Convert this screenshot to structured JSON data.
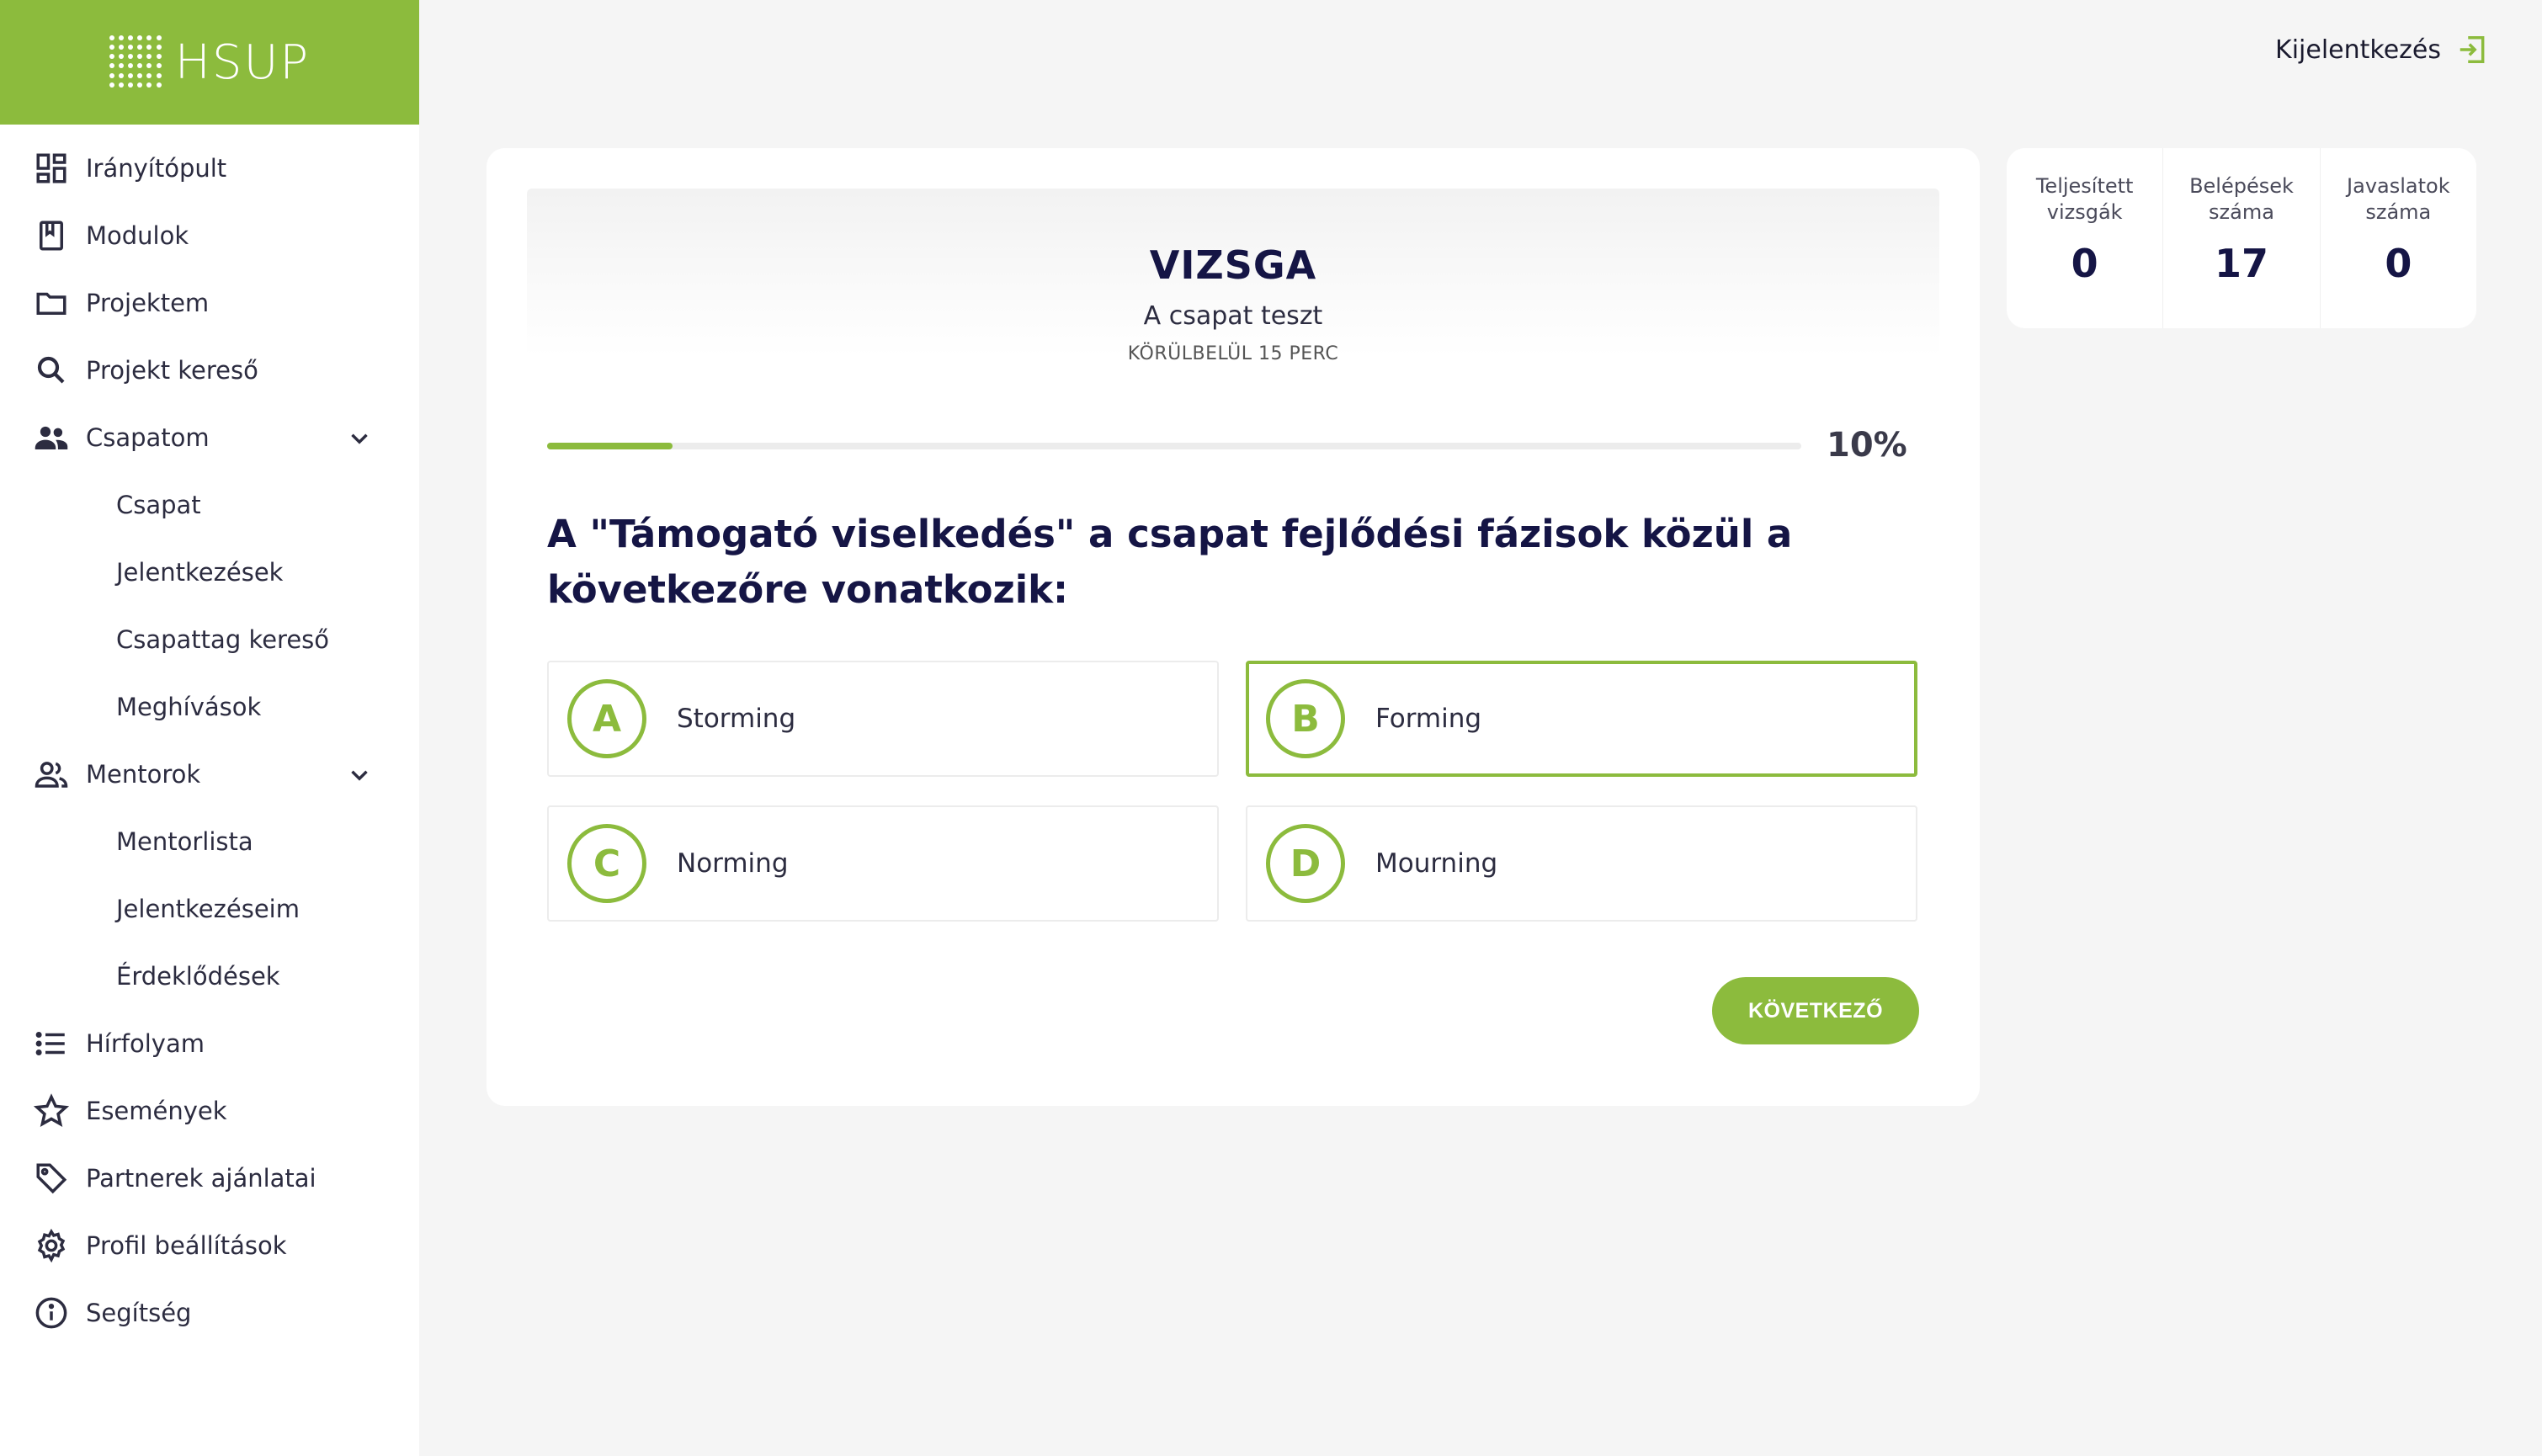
{
  "app": {
    "logo_text": "HSUP"
  },
  "topbar": {
    "logout_label": "Kijelentkezés"
  },
  "sidebar": {
    "items": [
      {
        "label": "Irányítópult",
        "icon": "dashboard-icon"
      },
      {
        "label": "Modulok",
        "icon": "book-icon"
      },
      {
        "label": "Projektem",
        "icon": "folder-icon"
      },
      {
        "label": "Projekt kereső",
        "icon": "search-icon"
      },
      {
        "label": "Csapatom",
        "icon": "group-icon",
        "expanded": true
      },
      {
        "label": "Csapat"
      },
      {
        "label": "Jelentkezések"
      },
      {
        "label": "Csapattag kereső"
      },
      {
        "label": "Meghívások"
      },
      {
        "label": "Mentorok",
        "icon": "people-outline-icon",
        "expanded": true
      },
      {
        "label": "Mentorlista"
      },
      {
        "label": "Jelentkezéseim"
      },
      {
        "label": "Érdeklődések"
      },
      {
        "label": "Hírfolyam",
        "icon": "list-icon"
      },
      {
        "label": "Események",
        "icon": "star-icon"
      },
      {
        "label": "Partnerek ajánlatai",
        "icon": "tag-icon"
      },
      {
        "label": "Profil beállítások",
        "icon": "gear-icon"
      },
      {
        "label": "Segítség",
        "icon": "info-icon"
      }
    ]
  },
  "exam": {
    "title": "VIZSGA",
    "subtitle": "A csapat teszt",
    "duration": "KÖRÜLBELÜL 15 PERC",
    "progress_value": 0.1,
    "progress_label": "10%",
    "question": "A \"Támogató viselkedés\" a csapat fejlődési fázisok közül a következőre vonatkozik:",
    "answers": [
      {
        "letter": "A",
        "label": "Storming",
        "selected": false
      },
      {
        "letter": "B",
        "label": "Forming",
        "selected": true
      },
      {
        "letter": "C",
        "label": "Norming",
        "selected": false
      },
      {
        "letter": "D",
        "label": "Mourning",
        "selected": false
      }
    ],
    "next_label": "KÖVETKEZŐ"
  },
  "stats": [
    {
      "label": "Teljesített vizsgák",
      "value": "0"
    },
    {
      "label": "Belépések száma",
      "value": "17"
    },
    {
      "label": "Javaslatok száma",
      "value": "0"
    }
  ],
  "colors": {
    "accent": "#8cbb3d",
    "navy": "#151545",
    "background": "#f5f5f5"
  }
}
